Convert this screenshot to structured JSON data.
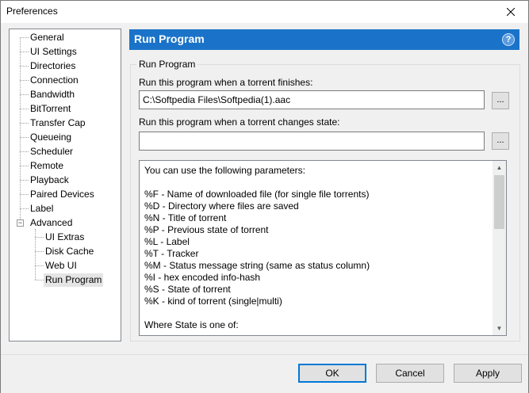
{
  "window": {
    "title": "Preferences"
  },
  "tree": {
    "items": [
      {
        "label": "General"
      },
      {
        "label": "UI Settings"
      },
      {
        "label": "Directories"
      },
      {
        "label": "Connection"
      },
      {
        "label": "Bandwidth"
      },
      {
        "label": "BitTorrent"
      },
      {
        "label": "Transfer Cap"
      },
      {
        "label": "Queueing"
      },
      {
        "label": "Scheduler"
      },
      {
        "label": "Remote"
      },
      {
        "label": "Playback"
      },
      {
        "label": "Paired Devices"
      },
      {
        "label": "Label"
      },
      {
        "label": "Advanced"
      }
    ],
    "children": [
      {
        "label": "UI Extras"
      },
      {
        "label": "Disk Cache"
      },
      {
        "label": "Web UI"
      },
      {
        "label": "Run Program"
      }
    ],
    "expander_symbol": "−"
  },
  "header": {
    "title": "Run Program",
    "help_symbol": "?"
  },
  "group": {
    "title": "Run Program",
    "finish_label": "Run this program when a torrent finishes:",
    "finish_value": "C:\\Softpedia Files\\Softpedia(1).aac",
    "change_label": "Run this program when a torrent changes state:",
    "change_value": "",
    "browse_label": "..."
  },
  "params": {
    "lines": [
      "You can use the following parameters:",
      "",
      "%F - Name of downloaded file (for single file torrents)",
      "%D - Directory where files are saved",
      "%N - Title of torrent",
      "%P - Previous state of torrent",
      "%L - Label",
      "%T - Tracker",
      "%M - Status message string (same as status column)",
      "%I - hex encoded info-hash",
      "%S - State of torrent",
      "%K - kind of torrent (single|multi)",
      "",
      "Where State is one of:"
    ]
  },
  "buttons": {
    "ok": "OK",
    "cancel": "Cancel",
    "apply": "Apply"
  },
  "colors": {
    "header_bg": "#1a73c9",
    "accent": "#0078d7"
  }
}
